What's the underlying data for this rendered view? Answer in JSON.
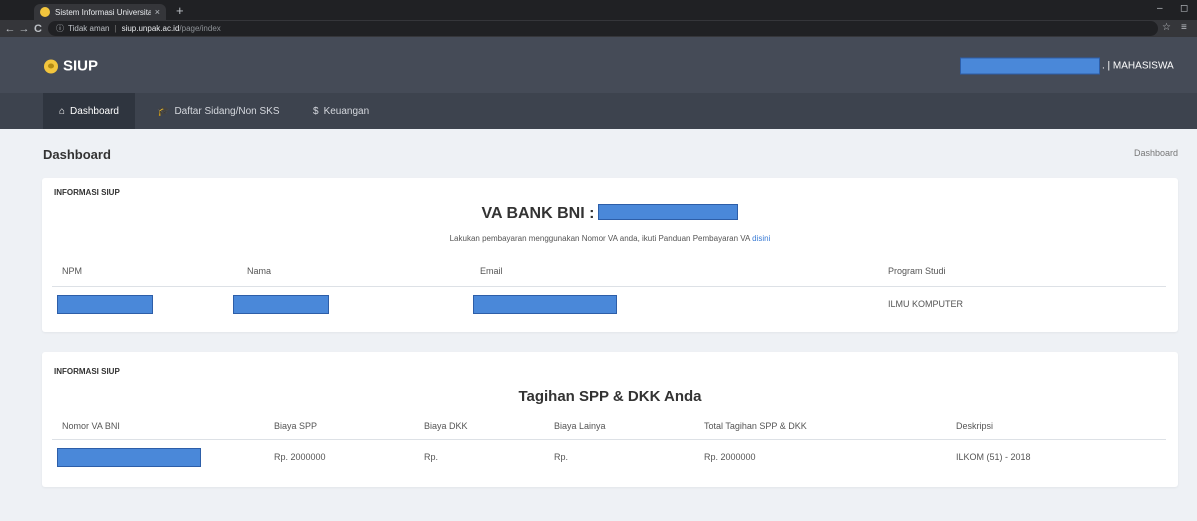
{
  "browser": {
    "tab_title": "Sistem Informasi Universitas Pak",
    "tab_close": "×",
    "new_tab": "+",
    "back_icon": "←",
    "forward_icon": "→",
    "reload_icon": "C",
    "security_icon": "ⓘ",
    "security_label": "Tidak aman",
    "url_host": "siup.unpak.ac.id",
    "url_path": "/page/index",
    "star_icon": "☆",
    "menu_icon": "≡",
    "minimize_icon": "–",
    "restore_icon": "◻"
  },
  "header": {
    "brand": "SIUP",
    "role": ". | MAHASISWA"
  },
  "menu": [
    {
      "icon": "⌂",
      "label": "Dashboard"
    },
    {
      "icon": "🎓",
      "label": "Daftar Sidang/Non SKS"
    },
    {
      "icon": "$",
      "label": "Keuangan"
    }
  ],
  "page": {
    "title": "Dashboard",
    "breadcrumb": "Dashboard"
  },
  "card1": {
    "label": "INFORMASI SIUP",
    "va_label": "VA BANK BNI :",
    "note": "Lakukan pembayaran menggunakan Nomor VA anda, ikuti Panduan Pembayaran VA",
    "note_link": "disini",
    "columns": [
      "NPM",
      "Nama",
      "Email",
      "Program Studi"
    ],
    "row": {
      "program_studi": "ILMU KOMPUTER"
    }
  },
  "card2": {
    "label": "INFORMASI SIUP",
    "title": "Tagihan SPP & DKK Anda",
    "columns": [
      "Nomor VA BNI",
      "Biaya SPP",
      "Biaya DKK",
      "Biaya Lainya",
      "Total Tagihan SPP & DKK",
      "Deskripsi"
    ],
    "row": {
      "biaya_spp": "Rp. 2000000",
      "biaya_dkk": "Rp.",
      "biaya_lainya": "Rp.",
      "total": "Rp. 2000000",
      "deskripsi": "ILKOM (51) - 2018"
    }
  },
  "colors": {
    "header_bg": "#454b57",
    "menu_bg": "#3d434e",
    "menu_active_bg": "#2f353f",
    "page_bg": "#eef1f5",
    "redaction": "#4a88d9",
    "link": "#3a7bd5"
  }
}
